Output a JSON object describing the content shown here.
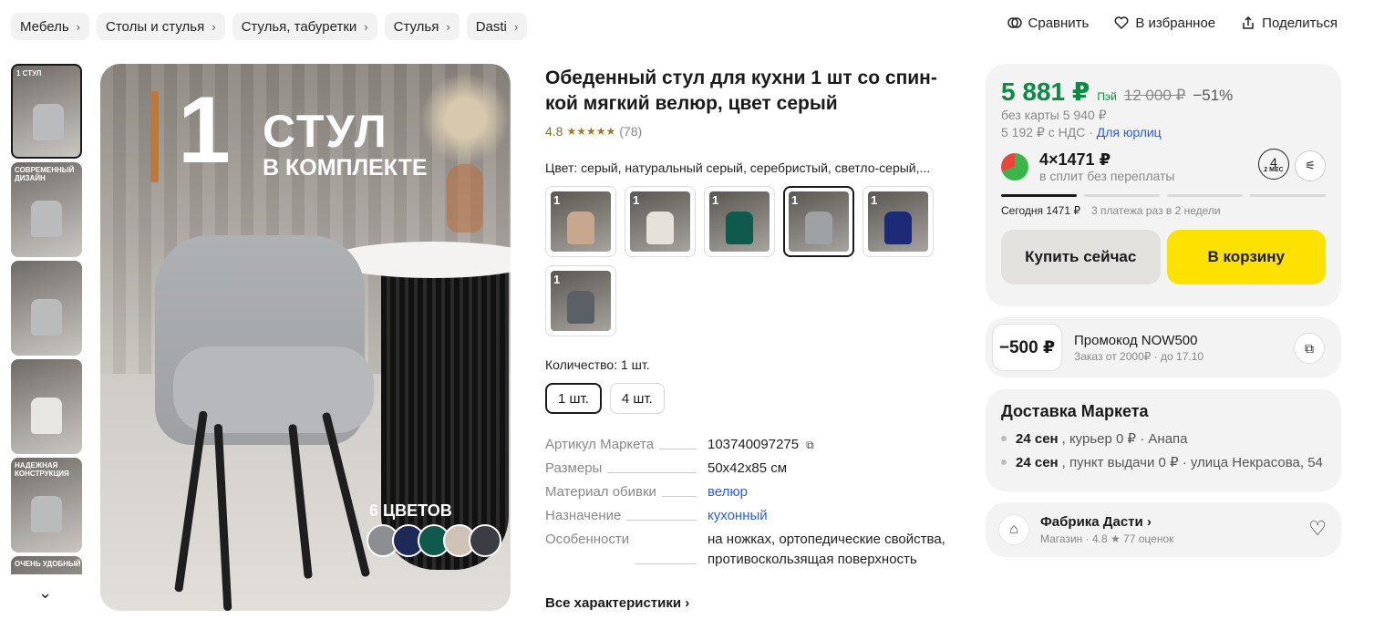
{
  "breadcrumbs": [
    "Мебель",
    "Столы и стулья",
    "Стулья, табуретки",
    "Стулья",
    "Dasti"
  ],
  "top_actions": {
    "compare": "Сравнить",
    "favorites": "В избранное",
    "share": "Поделиться"
  },
  "gallery": {
    "banner_number": "1",
    "banner_line1": "СТУЛ",
    "banner_line2": "В КОМПЛЕКТЕ",
    "colors_label": "6 ЦВЕТОВ",
    "swatch_colors": [
      "#8c8e91",
      "#1d2a57",
      "#0f5a4c",
      "#cfc3b7",
      "#3a3d42"
    ],
    "thumb_tags": [
      "1 СТУЛ",
      "СОВРЕМЕННЫЙ ДИЗАЙН",
      "",
      "",
      "НАДЕЖНАЯ КОНСТРУКЦИЯ",
      "ОЧЕНЬ УДОБНЫЙ"
    ]
  },
  "product": {
    "title": "Обеденный стул для кухни 1 шт со спин-кой мягкий велюр, цвет серый",
    "rating": "4.8",
    "stars": "★★★★★",
    "reviews": "(78)",
    "color_label": "Цвет:",
    "color_value": "серый, натуральный серый, серебристый, светло-серый,...",
    "variant_colors": [
      "#c8a78f",
      "#e6e1da",
      "#0f5a4c",
      "#9ea1a4",
      "#1d2a77",
      "#5b6066"
    ],
    "qty_label": "Количество:",
    "qty_value": "1 шт.",
    "qty_options": [
      "1 шт.",
      "4 шт."
    ],
    "specs": [
      {
        "k": "Артикул Маркета",
        "v": "103740097275"
      },
      {
        "k": "Размеры",
        "v": "50x42x85 см"
      },
      {
        "k": "Материал обивки",
        "v": "велюр"
      },
      {
        "k": "Назначение",
        "v": "кухонный"
      },
      {
        "k": "Особенности",
        "v": "на ножках, ортопедические свойства, противоскользящая поверхность"
      }
    ],
    "all_specs": "Все характеристики ›"
  },
  "buy": {
    "price": "5 881 ₽",
    "pay_badge": "Пэй",
    "old_price": "12 000 ₽",
    "discount": "−51%",
    "no_card": "без карты 5 940 ₽",
    "vat_text": "5 192 ₽ с НДС ·",
    "legal_link": "Для юрлиц",
    "split_main": "4×1471 ₽",
    "split_sub": "в сплит без переплаты",
    "months_num": "4",
    "months_label": "2 МЕС",
    "today": "Сегодня 1471 ₽",
    "schedule": "3 платежа раз в 2 недели",
    "buy_now": "Купить сейчас",
    "to_cart": "В корзину"
  },
  "promo": {
    "badge": "−500 ₽",
    "title": "Промокод NOW500",
    "sub": "Заказ от 2000₽ · до 17.10"
  },
  "delivery": {
    "title": "Доставка Маркета",
    "row1_date": "24 сен",
    "row1_rest": ", курьер 0 ₽ · Анапа",
    "row2_date": "24 сен",
    "row2_rest": ", пункт выдачи 0 ₽ · улица Некрасова, 54"
  },
  "shop": {
    "name": "Фабрика Дасти ›",
    "sub": "Магазин · 4.8 ★ 77 оценок"
  }
}
